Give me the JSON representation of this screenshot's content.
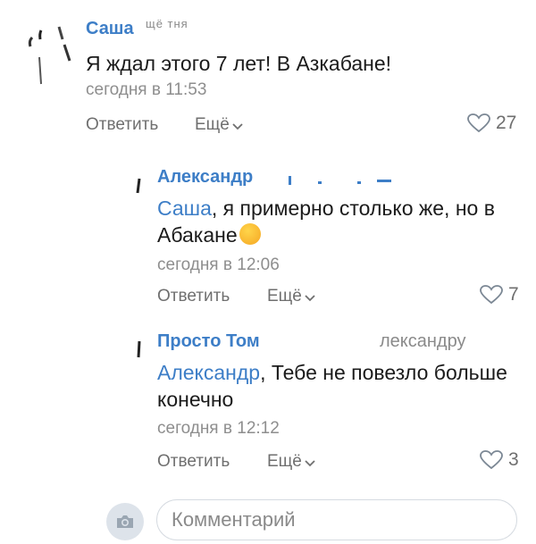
{
  "comments": [
    {
      "author": "Саша",
      "author_note": "щё тня",
      "text": "Я ждал этого 7 лет! В Азкабане!",
      "time": "сегодня в 11:53",
      "reply_label": "Ответить",
      "more_label": "Ещё",
      "likes": "27"
    },
    {
      "author": "Александр",
      "mention": "Саша",
      "text_after_mention": ", я примерно столько же, но в Абакане",
      "time": "сегодня в 12:06",
      "reply_label": "Ответить",
      "more_label": "Ещё",
      "likes": "7"
    },
    {
      "author": "Просто Том",
      "author_note": "лександру",
      "mention": "Александр",
      "text_after_mention": ", Тебе не повезло больше конечно",
      "time": "сегодня в 12:12",
      "reply_label": "Ответить",
      "more_label": "Ещё",
      "likes": "3"
    }
  ],
  "composer": {
    "placeholder": "Комментарий",
    "camera_icon": "camera-icon"
  },
  "colors": {
    "link": "#3d7ec7",
    "secondary": "#8e8e8e",
    "action": "#6f6f6f",
    "like_outline": "#7b8794"
  }
}
